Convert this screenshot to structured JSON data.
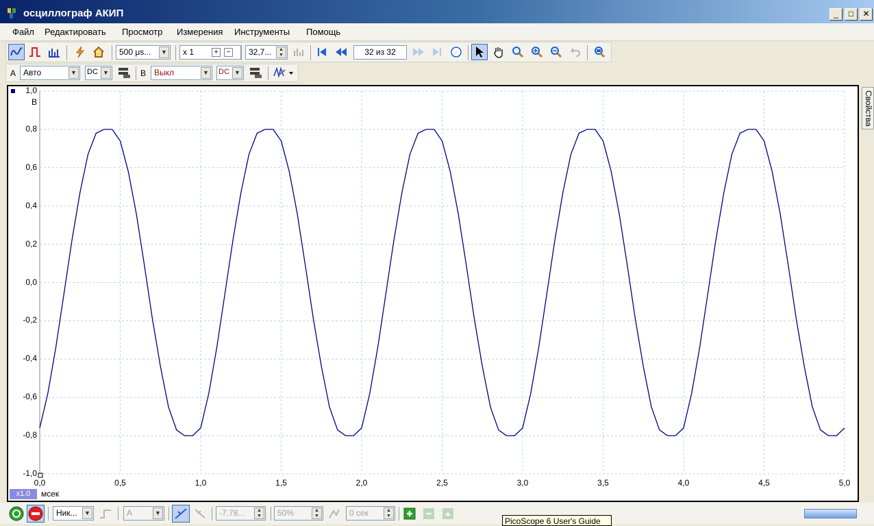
{
  "window": {
    "title": "осциллограф АКИП",
    "min_label": "_",
    "max_label": "□",
    "close_label": "✕"
  },
  "menu": [
    "Файл",
    "Редактировать",
    "Просмотр",
    "Измерения",
    "Инструменты",
    "Помощь"
  ],
  "toolbar": {
    "timebase": "500 μs...",
    "multiplier": "x 1",
    "samples": "32,7...",
    "buffer_position": "32 из 32",
    "plus_label": "+",
    "minus_label": "−"
  },
  "channels": {
    "a": {
      "label": "A",
      "range": "Авто",
      "coupling": "DC"
    },
    "b": {
      "label": "B",
      "range": "Выкл",
      "coupling": "DC"
    }
  },
  "side_tab": "Свойства",
  "plot": {
    "y_unit": "В",
    "x_unit": "мсек",
    "zoom": "x1.0",
    "ticks": {
      "y": [
        "1,0",
        "0,8",
        "0,6",
        "0,4",
        "0,2",
        "0,0",
        "-0,2",
        "-0,4",
        "-0,6",
        "-0,8",
        "-1,0"
      ],
      "x": [
        "0,0",
        "0,5",
        "1,0",
        "1,5",
        "2,0",
        "2,5",
        "3,0",
        "3,5",
        "4,0",
        "4,5",
        "5,0"
      ]
    }
  },
  "chart_data": {
    "type": "line",
    "x_range": [
      0,
      5
    ],
    "ylim": [
      -1.0,
      1.0
    ],
    "grid": true,
    "series": [
      {
        "color": "#000080",
        "x": [
          0.0,
          0.05,
          0.1,
          0.15,
          0.2,
          0.25,
          0.3,
          0.35,
          0.4,
          0.45,
          0.5,
          0.55,
          0.6,
          0.65,
          0.7,
          0.75,
          0.8,
          0.85,
          0.9,
          0.95,
          1.0,
          1.05,
          1.1,
          1.15,
          1.2,
          1.25,
          1.3,
          1.35,
          1.4,
          1.45,
          1.5,
          1.55,
          1.6,
          1.65,
          1.7,
          1.75,
          1.8,
          1.85,
          1.9,
          1.95,
          2.0,
          2.05,
          2.1,
          2.15,
          2.2,
          2.25,
          2.3,
          2.35,
          2.4,
          2.45,
          2.5,
          2.55,
          2.6,
          2.65,
          2.7,
          2.75,
          2.8,
          2.85,
          2.9,
          2.95,
          3.0,
          3.05,
          3.1,
          3.15,
          3.2,
          3.25,
          3.3,
          3.35,
          3.4,
          3.45,
          3.5,
          3.55,
          3.6,
          3.65,
          3.7,
          3.75,
          3.8,
          3.85,
          3.9,
          3.95,
          4.0,
          4.05,
          4.1,
          4.15,
          4.2,
          4.25,
          4.3,
          4.35,
          4.4,
          4.45,
          4.5,
          4.55,
          4.6,
          4.65,
          4.7,
          4.75,
          4.8,
          4.85,
          4.9,
          4.95,
          5.0
        ],
        "y": [
          -0.76,
          -0.58,
          -0.34,
          -0.06,
          0.22,
          0.47,
          0.67,
          0.78,
          0.8,
          0.8,
          0.74,
          0.58,
          0.36,
          0.09,
          -0.19,
          -0.44,
          -0.65,
          -0.77,
          -0.8,
          -0.8,
          -0.76,
          -0.58,
          -0.34,
          -0.06,
          0.22,
          0.47,
          0.67,
          0.78,
          0.8,
          0.8,
          0.74,
          0.58,
          0.36,
          0.09,
          -0.19,
          -0.44,
          -0.65,
          -0.77,
          -0.8,
          -0.8,
          -0.76,
          -0.58,
          -0.34,
          -0.06,
          0.22,
          0.47,
          0.67,
          0.78,
          0.8,
          0.8,
          0.74,
          0.58,
          0.36,
          0.09,
          -0.19,
          -0.44,
          -0.65,
          -0.77,
          -0.8,
          -0.8,
          -0.76,
          -0.58,
          -0.34,
          -0.06,
          0.22,
          0.47,
          0.67,
          0.78,
          0.8,
          0.8,
          0.74,
          0.58,
          0.36,
          0.09,
          -0.19,
          -0.44,
          -0.65,
          -0.77,
          -0.8,
          -0.8,
          -0.76,
          -0.58,
          -0.34,
          -0.06,
          0.22,
          0.47,
          0.67,
          0.78,
          0.8,
          0.8,
          0.74,
          0.58,
          0.36,
          0.09,
          -0.19,
          -0.44,
          -0.65,
          -0.77,
          -0.8,
          -0.8,
          -0.76
        ]
      }
    ]
  },
  "bottom": {
    "trigger_mode": "Ник...",
    "trigger_source": "A",
    "threshold": "-7,78...",
    "pretrigger": "50%",
    "delay": "0 сек"
  },
  "tooltip": "PicoScope 6 User's Guide"
}
